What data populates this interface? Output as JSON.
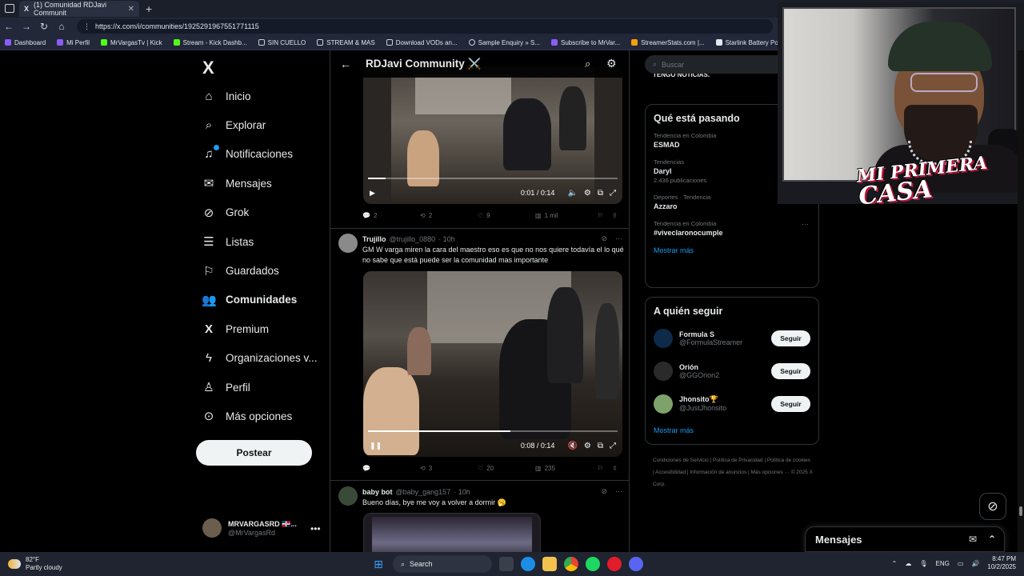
{
  "browser": {
    "tab_title": "(1) Comunidad RDJavi Communit",
    "url": "https://x.com/i/communities/1925291967551771115",
    "bookmarks": [
      "Dashboard",
      "Mi Perfil",
      "MrVargasTv | Kick",
      "Stream - Kick Dashb...",
      "SIN CUELLO",
      "STREAM & MAS",
      "Download VODs an...",
      "Sample Enquiry » S...",
      "Subscribe to MrVar...",
      "StreamerStats.com |...",
      "Starlink Battery Pow..."
    ]
  },
  "sidebar": {
    "logo": "X",
    "items": [
      {
        "label": "Inicio",
        "icon": "home-icon",
        "glyph": "⌂"
      },
      {
        "label": "Explorar",
        "icon": "search-icon",
        "glyph": "⌕"
      },
      {
        "label": "Notificaciones",
        "icon": "bell-icon",
        "glyph": "🔔"
      },
      {
        "label": "Mensajes",
        "icon": "mail-icon",
        "glyph": "✉"
      },
      {
        "label": "Grok",
        "icon": "grok-icon",
        "glyph": "◌"
      },
      {
        "label": "Listas",
        "icon": "list-icon",
        "glyph": "☰"
      },
      {
        "label": "Guardados",
        "icon": "bookmark-icon",
        "glyph": "⚑"
      },
      {
        "label": "Comunidades",
        "icon": "communities-icon",
        "glyph": "👥"
      },
      {
        "label": "Premium",
        "icon": "x-premium-icon",
        "glyph": "X"
      },
      {
        "label": "Organizaciones v...",
        "icon": "lightning-icon",
        "glyph": "⚡"
      },
      {
        "label": "Perfil",
        "icon": "person-icon",
        "glyph": "👤"
      },
      {
        "label": "Más opciones",
        "icon": "more-circle-icon",
        "glyph": "⋯"
      }
    ],
    "post_button": "Postear",
    "account": {
      "name": "MRVARGASRD 🇩🇴...",
      "handle": "@MrVargasRd"
    }
  },
  "community": {
    "title": "RDJavi Community ⚔️",
    "tweets": [
      {
        "video_time": "0:01 / 0:14",
        "progress": 0.07,
        "replies": "2",
        "reposts": "2",
        "likes": "9",
        "views": "1 mil"
      },
      {
        "name": "Trujillo",
        "handle": "@trujillo_0880",
        "time": "· 10h",
        "text": "GM W varga miren la cara del maestro eso es que no nos quiere todavía el lo qué no sabe que está puede ser la comunidad mas importante",
        "video_time": "0:08 / 0:14",
        "progress": 0.57,
        "replies": "",
        "reposts": "3",
        "likes": "20",
        "views": "235"
      },
      {
        "name": "baby bot",
        "handle": "@baby_gang157",
        "time": "· 10h",
        "text": "Bueno días, bye me voy a volver a dormir 🥱"
      }
    ]
  },
  "right": {
    "search_placeholder": "Buscar",
    "prev_snippet": "TENGO NOTICIAS.",
    "trends_title": "Qué está pasando",
    "trends": [
      {
        "meta": "Tendencia en Colombia",
        "topic": "ESMAD",
        "count": ""
      },
      {
        "meta": "Tendencias",
        "topic": "Daryl",
        "count": "2.436 publicaciones"
      },
      {
        "meta": "Deportes · Tendencia",
        "topic": "Azzaro",
        "count": ""
      },
      {
        "meta": "Tendencia en Colombia",
        "topic": "#viveclaronocumple",
        "count": ""
      }
    ],
    "show_more": "Mostrar más",
    "follow_title": "A quién seguir",
    "follow": [
      {
        "name": "Formula S",
        "handle": "@FormulaStreamer",
        "button": "Seguir"
      },
      {
        "name": "Orión",
        "handle": "@GGOrion2",
        "button": "Seguir"
      },
      {
        "name": "Jhonsito🏆",
        "handle": "@JustJhonsito",
        "button": "Seguir"
      }
    ],
    "footer": "Condiciones de Servicio | Política de Privacidad | Política de cookies | Accesibilidad | Información de anuncios | Más opciones ··· © 2025 X Corp."
  },
  "webcam": {
    "overlay_text_line1": "MI PRIMERA",
    "overlay_text_line2": "CASA"
  },
  "messages": {
    "title": "Mensajes"
  },
  "taskbar": {
    "temp": "82°F",
    "weather": "Partly cloudy",
    "search": "Search",
    "lang": "ENG",
    "time": "8:47 PM",
    "date": "10/2/2025"
  }
}
